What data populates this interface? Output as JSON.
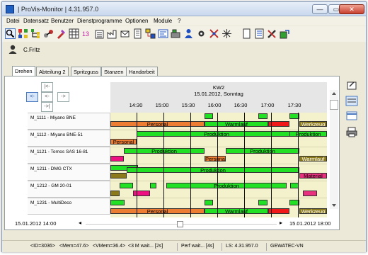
{
  "window": {
    "title": "| ProVis-Monitor | 4.31.957.0",
    "min_label": "—",
    "max_label": "▭",
    "close_label": "✕"
  },
  "menu": [
    "Datei",
    "Datensatz",
    "Benutzer",
    "Dienstprogramme",
    "Optionen",
    "Module",
    "?"
  ],
  "toolbar": {
    "icons": [
      "search-icon",
      "network-icon",
      "tree-icon",
      "link-icon",
      "tool-icon",
      "calendar-grid-icon",
      "calendar-13-icon",
      "building-icon",
      "factory-icon",
      "mail-icon",
      "document-icon",
      "workflow-icon",
      "dispatch-icon",
      "machine-icon",
      "user-icon",
      "config-icon",
      "clamp-icon",
      "connect-icon",
      "page-icon",
      "list-icon",
      "tools-icon",
      "export-icon"
    ]
  },
  "user": {
    "name": "C.Fritz"
  },
  "tabs": [
    "Drehen",
    "Abteilung 2",
    "Spritzguss",
    "Stanzen",
    "Handarbeit"
  ],
  "controls": {
    "first": "|<-",
    "prev": "<-",
    "next": "->",
    "last": "->|"
  },
  "chart": {
    "week": "KW2",
    "date": "15.01.2012, Sonntag",
    "time_labels": [
      "14:30",
      "15:00",
      "15:30",
      "16:00",
      "16:30",
      "17:00",
      "17:30"
    ]
  },
  "rows": [
    {
      "label": "M_1111 - Miyano BNE"
    },
    {
      "label": "M_1112 - Miyano BNE-51"
    },
    {
      "label": "M_1121 - Tornos SAS 16-81"
    },
    {
      "label": "M_1211 - DMG CTX"
    },
    {
      "label": "M_1212 - GM 20-01"
    },
    {
      "label": "M_1231 - MultiDeco"
    }
  ],
  "bar_texts": {
    "personal": "Personal",
    "warmlauf": "Warmlauf",
    "werkzeug": "Werkzeug",
    "produktion": "Produktion",
    "material": "Material"
  },
  "timebar": {
    "left": "15.01.2012 14:00",
    "right": "15.01.2012 18:00",
    "left_arrow": "◂",
    "right_arrow": "▸"
  },
  "status": {
    "id": "<ID=3036>",
    "mem": "<Mem=47.6>",
    "vmem": "<VMem=36.4>",
    "wait": "<3 M wait... [2s]",
    "perf": "Perf wait... [4s]",
    "ls": "LS: 4.31.957.0",
    "gewatec": "GEWATEC-VN"
  },
  "colors": {
    "produktion": "#22e024",
    "personal": "#ee7d34",
    "warmlauf": "#22e024",
    "stoerung": "#f01818",
    "werkzeug": "#8c7a1a",
    "material": "#e8307e",
    "row_bg": "#f4f2cc"
  }
}
